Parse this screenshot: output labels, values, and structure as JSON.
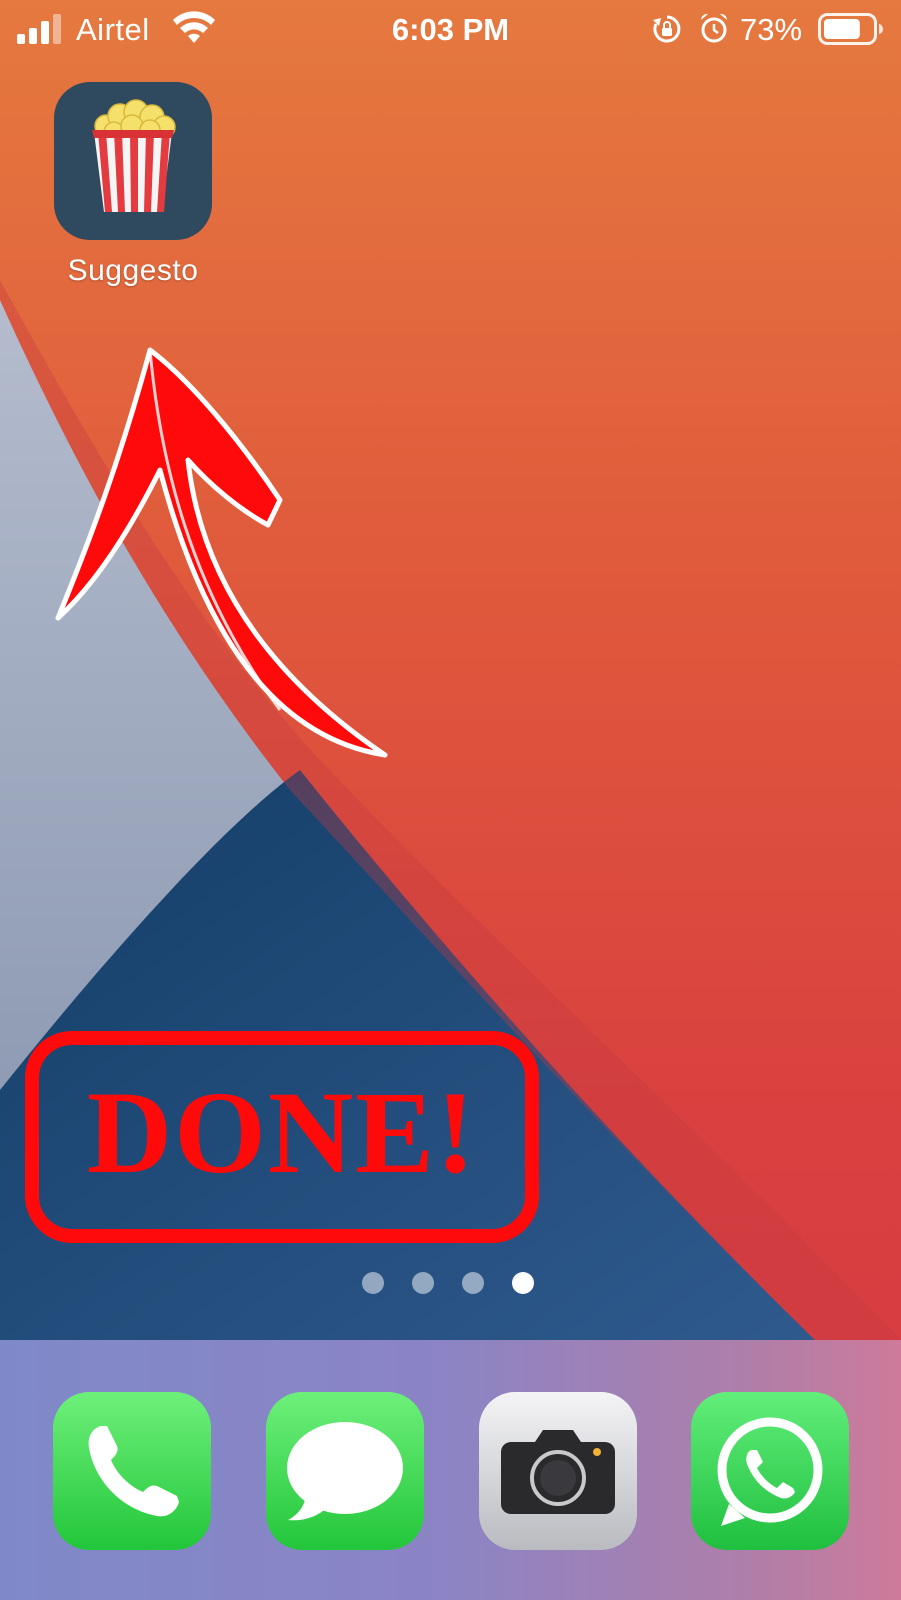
{
  "status_bar": {
    "carrier": "Airtel",
    "time": "6:03 PM",
    "battery_percent": "73%",
    "icons": [
      "signal-icon",
      "wifi-icon",
      "rotation-lock-icon",
      "alarm-icon",
      "battery-icon"
    ],
    "battery_level": 0.73
  },
  "home_screen": {
    "apps": [
      {
        "label": "Suggesto",
        "icon": "popcorn-icon"
      }
    ],
    "page_count": 4,
    "current_page": 4
  },
  "annotation": {
    "stamp_text": "DONE!",
    "arrow": "arrow-up-icon",
    "color": "#ff0a0a"
  },
  "dock": {
    "apps": [
      "phone-icon",
      "messages-icon",
      "camera-icon",
      "whatsapp-icon"
    ]
  },
  "colors": {
    "wallpaper_orange": "#e66a3c",
    "wallpaper_red": "#d9403f",
    "wallpaper_gray": "#a6b0c4",
    "wallpaper_navy": "#1f4c78",
    "app_tile": "#2f4a5e",
    "dock_green": "#22c63a"
  }
}
